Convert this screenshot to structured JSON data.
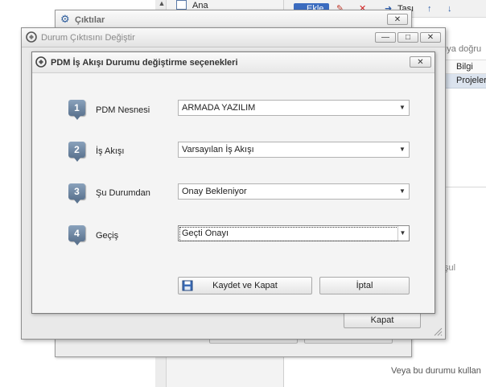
{
  "background": {
    "tree_item": "Ana",
    "toolbar": {
      "edit_label": "Ekle",
      "move_label": "Taşı"
    },
    "right_header": "ağıya doğru",
    "table_header": "Bilgi",
    "table_row": "Projeler",
    "side_label": "şul",
    "alt_label": "Veya bu durumu kullan"
  },
  "outputs_window": {
    "title": "Çıktılar"
  },
  "status_window": {
    "title": "Durum Çıktısını Değiştir",
    "close_button_label": "Kapat"
  },
  "dialog": {
    "title": "PDM İş Akışı Durumu değiştirme seçenekleri",
    "steps": [
      {
        "number": "1",
        "label": "PDM Nesnesi",
        "value": "ARMADA YAZILIM"
      },
      {
        "number": "2",
        "label": "İş Akışı",
        "value": "Varsayılan İş Akışı"
      },
      {
        "number": "3",
        "label": "Şu Durumdan",
        "value": "Onay Bekleniyor"
      },
      {
        "number": "4",
        "label": "Geçiş",
        "value": "Geçti Onayı"
      }
    ],
    "save_button": "Kaydet ve Kapat",
    "cancel_button": "İptal"
  },
  "colors": {
    "badge": "#6d86a3",
    "toolbar_accent": "#3a6bbf",
    "selected_row": "#dbe3ee"
  }
}
